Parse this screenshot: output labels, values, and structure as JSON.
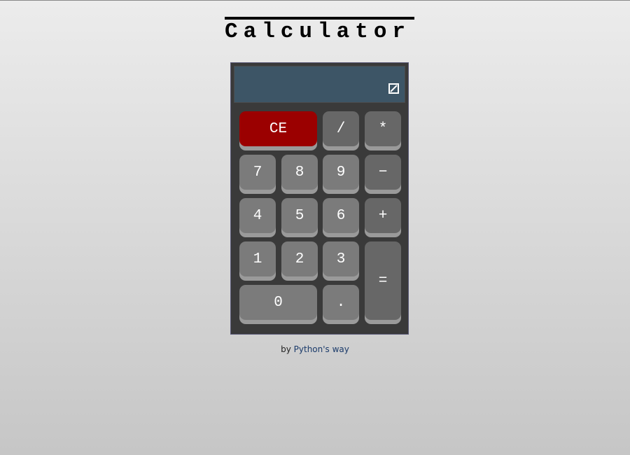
{
  "page": {
    "title": "Calculator"
  },
  "calculator": {
    "display": {
      "value": "",
      "icon": "edit-square-icon"
    },
    "buttons": {
      "clear": "CE",
      "divide": "/",
      "multiply": "*",
      "seven": "7",
      "eight": "8",
      "nine": "9",
      "minus": "−",
      "four": "4",
      "five": "5",
      "six": "6",
      "plus": "+",
      "one": "1",
      "two": "2",
      "three": "3",
      "equals": "=",
      "zero": "0",
      "decimal": "."
    },
    "colors": {
      "clear": "#9b0000",
      "digit": "#7b7b7b",
      "operator": "#676767",
      "display": "#3d5566",
      "body": "#3a3a3a"
    }
  },
  "footer": {
    "prefix": "by ",
    "link_label": "Python's way",
    "link_color": "#1a3a6a"
  }
}
